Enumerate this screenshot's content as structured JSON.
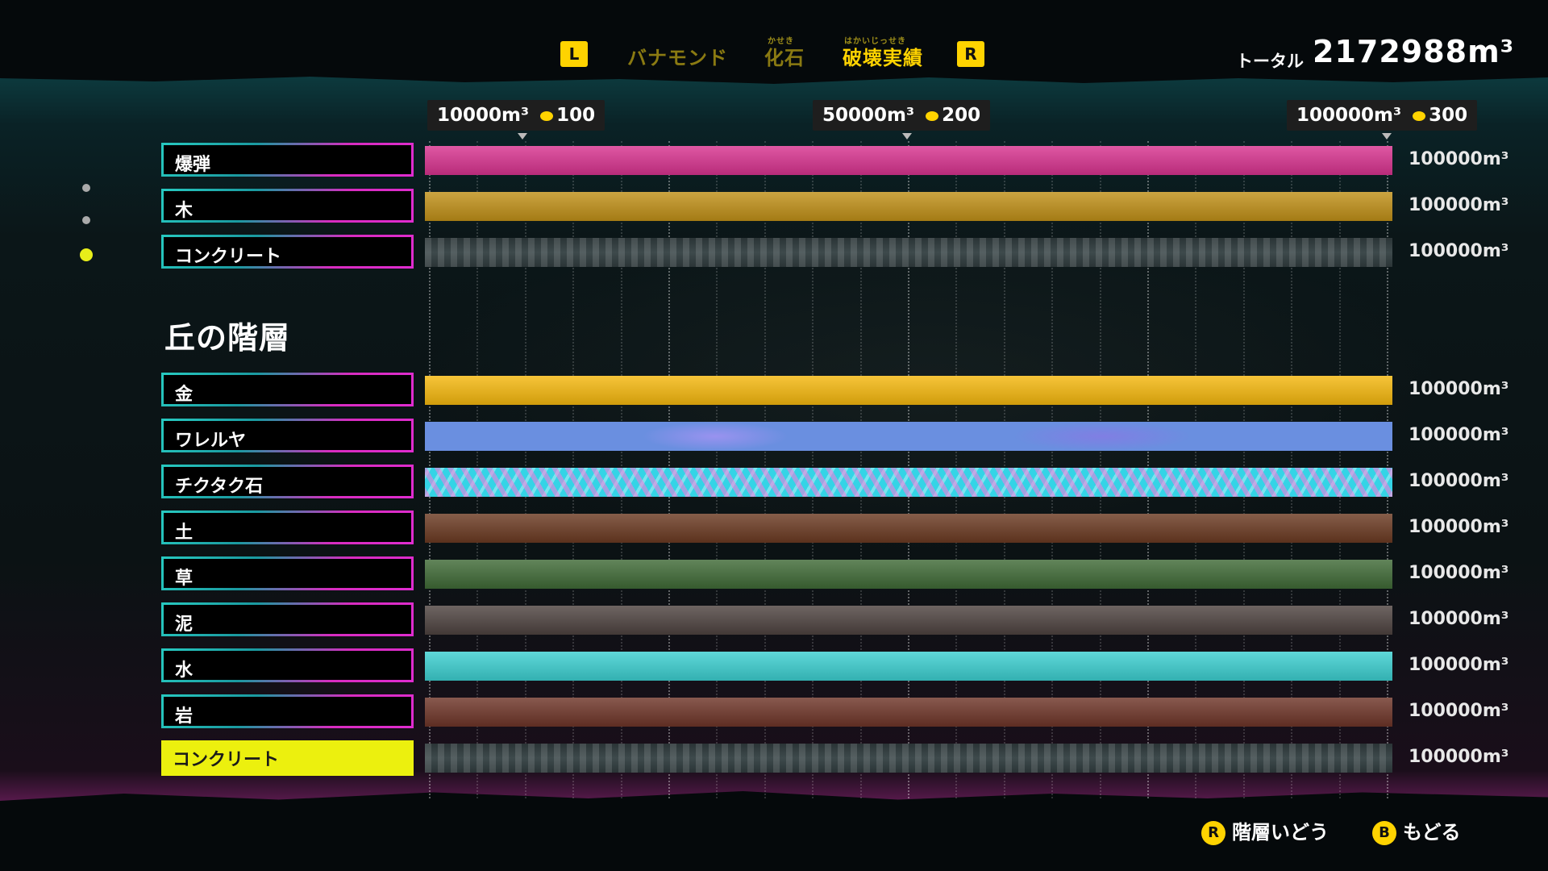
{
  "header": {
    "l_key": "L",
    "r_key": "R",
    "tabs": [
      {
        "label": "バナモンド",
        "ruby": ""
      },
      {
        "label": "化石",
        "ruby": "かせき"
      },
      {
        "label": "破壊実績",
        "ruby": "はかいじっせき"
      }
    ],
    "total_label": "トータル",
    "total_value": "2172988m³"
  },
  "milestones": [
    {
      "volume": "10000m³",
      "reward": "100"
    },
    {
      "volume": "50000m³",
      "reward": "200"
    },
    {
      "volume": "100000m³",
      "reward": "300"
    }
  ],
  "sections": [
    {
      "title": "",
      "rows": [
        {
          "label": "爆弾",
          "value": "100000m³",
          "progress": 1.0,
          "color": "#d8338f"
        },
        {
          "label": "木",
          "value": "100000m³",
          "progress": 1.0,
          "color": "#c09018"
        },
        {
          "label": "コンクリート",
          "value": "100000m³",
          "progress": 1.0,
          "color": "#3e4a4c"
        }
      ]
    },
    {
      "title": "丘の階層",
      "rows": [
        {
          "label": "金",
          "value": "100000m³",
          "progress": 1.0,
          "color": "#f5b80e"
        },
        {
          "label": "ワレルヤ",
          "value": "100000m³",
          "progress": 1.0,
          "color": "#6a8fe0"
        },
        {
          "label": "チクタク石",
          "value": "100000m³",
          "progress": 1.0,
          "color": "#34d4e6"
        },
        {
          "label": "土",
          "value": "100000m³",
          "progress": 1.0,
          "color": "#6b3a22"
        },
        {
          "label": "草",
          "value": "100000m³",
          "progress": 1.0,
          "color": "#3f6a36"
        },
        {
          "label": "泥",
          "value": "100000m³",
          "progress": 1.0,
          "color": "#4e4340"
        },
        {
          "label": "水",
          "value": "100000m³",
          "progress": 1.0,
          "color": "#3ccfd0"
        },
        {
          "label": "岩",
          "value": "100000m³",
          "progress": 1.0,
          "color": "#6e3528"
        },
        {
          "label": "コンクリート",
          "value": "100000m³",
          "progress": 1.0,
          "color": "#3e4a4c",
          "selected": true
        }
      ]
    }
  ],
  "footer": {
    "move_key": "R",
    "move_label": "階層いどう",
    "back_key": "B",
    "back_label": "もどる"
  }
}
